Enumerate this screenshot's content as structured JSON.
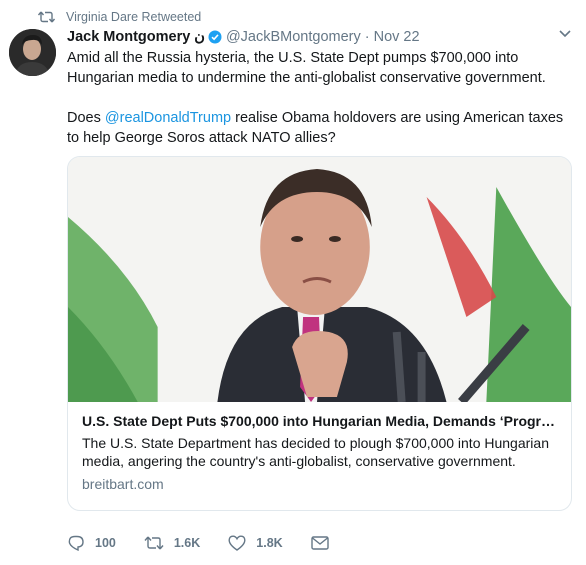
{
  "retweet": {
    "text": "Virginia Dare Retweeted",
    "icon": "retweet-icon"
  },
  "author": {
    "name": "Jack Montgomery",
    "name_suffix": "ن",
    "verified_icon": "verified-badge-icon",
    "handle": "@JackBMontgomery",
    "separator": "·",
    "date": "Nov 22"
  },
  "tweet": {
    "paragraph1": "Amid all the Russia hysteria, the U.S. State Dept pumps $700,000 into Hungarian media to undermine the anti-globalist conservative government.",
    "p2_before": "Does ",
    "p2_mention": "@realDonaldTrump",
    "p2_after": " realise Obama holdovers are using American taxes to help George Soros attack NATO allies?"
  },
  "card": {
    "title": "U.S. State Dept Puts $700,000 into Hungarian Media, Demands ‘Progr…",
    "description": "The U.S. State Department has decided to plough $700,000 into Hungarian media, angering the country's anti-globalist, conservative government.",
    "domain": "breitbart.com"
  },
  "actions": {
    "reply_count": "100",
    "retweet_count": "1.6K",
    "like_count": "1.8K",
    "icons": [
      "reply-icon",
      "retweet-icon",
      "like-icon",
      "direct-message-icon"
    ]
  },
  "colors": {
    "link": "#1b95e0",
    "muted": "#657786",
    "verified": "#1da1f2"
  }
}
